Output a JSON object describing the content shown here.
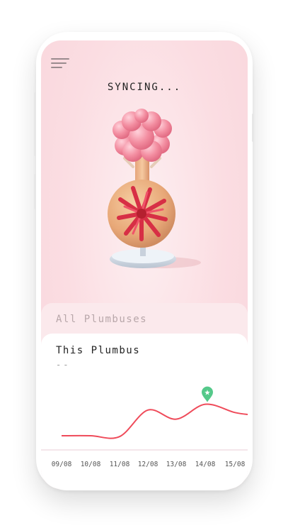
{
  "status_text": "SYNCING...",
  "back_card": {
    "title": "All Plumbuses"
  },
  "card": {
    "title": "This Plumbus",
    "subtitle": "--"
  },
  "icons": {
    "menu": "hamburger-menu-icon",
    "marker": "star-pin-icon"
  },
  "colors": {
    "background": "#f9d6dc",
    "line": "#ef4b5a",
    "marker": "#55c98a",
    "axis": "#f1dde4"
  },
  "chart_data": {
    "type": "line",
    "categories": [
      "09/08",
      "10/08",
      "11/08",
      "12/08",
      "13/08",
      "14/08",
      "15/08"
    ],
    "values": [
      1.2,
      1.2,
      1.1,
      4.3,
      3.2,
      5.0,
      4.0
    ],
    "highlight_index": 5,
    "ylim": [
      0,
      6
    ],
    "grid": false
  }
}
